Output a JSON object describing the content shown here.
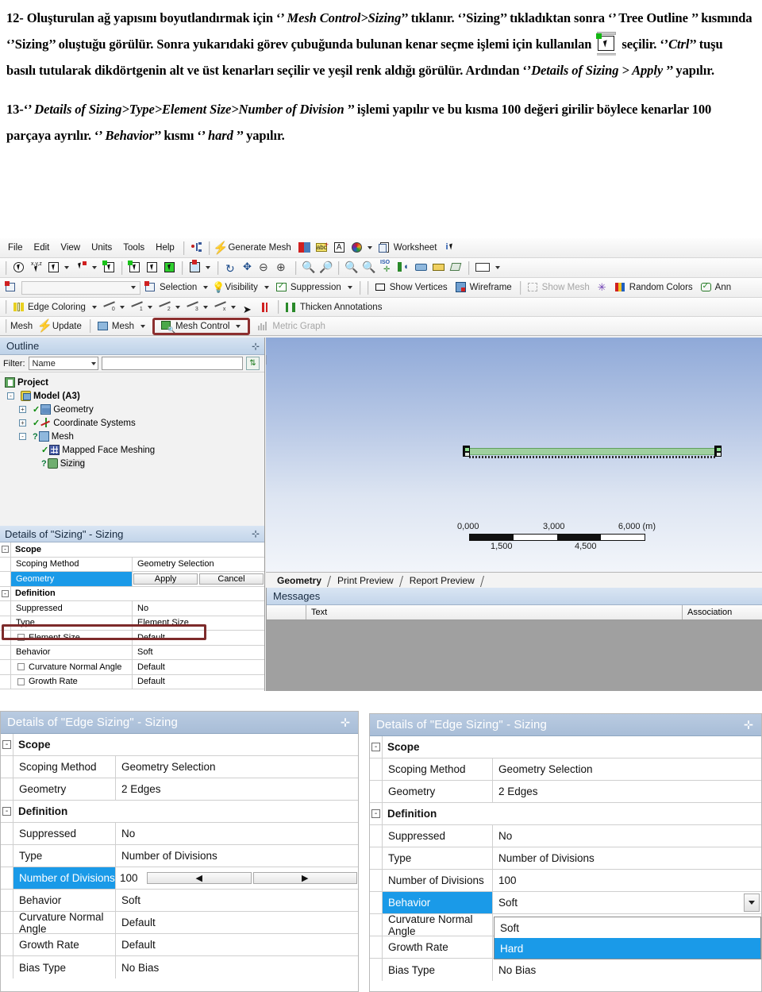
{
  "document": {
    "paragraph_12": {
      "prefix": "12- Oluşturulan ağ yapısını boyutlandırmak için ‘’ ",
      "em1": "Mesh Control>Sizing",
      "mid1": "’’ tıklanır.  ‘’Sizing’’ tıkladıktan sonra ‘’ Tree Outline ’’ kısmında ‘’Sizing’’ oluştuğu görülür. Sonra yukarıdaki  görev çubuğunda bulunan kenar seçme işlemi için kullanılan ",
      "mid2": " seçilir.  ‘’",
      "em2": "Ctrl",
      "mid3": "’’ tuşu basılı tutularak dikdörtgenin alt ve üst kenarları seçilir ve yeşil renk aldığı görülür. Ardından ‘’",
      "em3": "Details of Sizing > Apply",
      "suffix": " ’’ yapılır."
    },
    "paragraph_13": {
      "prefix": "13-‘’ ",
      "em1": "Details of Sizing>Type>Element Size>Number of Division",
      "mid1": " ’’ işlemi yapılır ve bu kısma 100 değeri girilir  böylece kenarlar 100 parçaya ayrılır. ‘’ ",
      "em2": "Behavior",
      "mid2": "’’ kısmı ‘’ ",
      "em3": "hard",
      "suffix": " ’’ yapılır."
    }
  },
  "app": {
    "menu": [
      "File",
      "Edit",
      "View",
      "Units",
      "Tools",
      "Help"
    ],
    "toolbar_row1": [
      {
        "label": "Generate Mesh",
        "icon": "lightning-icon"
      },
      {
        "label": "",
        "icon": "new-section-plane-icon"
      },
      {
        "label": "",
        "icon": "abc-label-icon"
      },
      {
        "label": "",
        "icon": "letter-a-icon"
      },
      {
        "label": "",
        "icon": "color-wheel-icon"
      },
      {
        "label": "Worksheet",
        "icon": "worksheet-icon"
      },
      {
        "label": "",
        "icon": "info-cursor-icon"
      }
    ],
    "toolbar_row3": [
      {
        "label": "Selection",
        "icon": "selection-icon"
      },
      {
        "label": "Visibility",
        "icon": "lightbulb-icon"
      },
      {
        "label": "Suppression",
        "icon": "suppression-icon"
      },
      {
        "label": "Show Vertices",
        "icon": "show-vertices-icon"
      },
      {
        "label": "Wireframe",
        "icon": "wireframe-icon"
      },
      {
        "label": "Show Mesh",
        "icon": "show-mesh-icon",
        "disabled": true
      },
      {
        "label": "",
        "icon": "edge-direction-icon"
      },
      {
        "label": "Random Colors",
        "icon": "random-colors-icon"
      },
      {
        "label": "Ann",
        "icon": "annotation-icon"
      }
    ],
    "toolbar_row4": [
      {
        "label": "Edge Coloring",
        "icon": "edge-coloring-icon"
      },
      {
        "label": "Thicken Annotations",
        "icon": "thicken-annotations-icon"
      }
    ],
    "toolbar_row5": {
      "mesh_label": "Mesh",
      "update_label": "Update",
      "mesh_menu_label": "Mesh",
      "mesh_control_label": "Mesh Control",
      "metric_graph_label": "Metric Graph",
      "highlight_color": "#8c2f2f"
    }
  },
  "outline": {
    "title": "Outline",
    "pin": "⊹",
    "filter": {
      "label": "Filter:",
      "selected": "Name",
      "value": "",
      "refresh_icon": "refresh-icon"
    },
    "tree": [
      {
        "label": "Project",
        "depth": 0,
        "icon": "project-icon",
        "bold": true,
        "expander": "",
        "status": ""
      },
      {
        "label": "Model (A3)",
        "depth": 1,
        "icon": "model-icon",
        "bold": true,
        "expander": "-",
        "status": ""
      },
      {
        "label": "Geometry",
        "depth": 2,
        "icon": "geometry-icon",
        "bold": false,
        "expander": "+",
        "status": "check"
      },
      {
        "label": "Coordinate Systems",
        "depth": 2,
        "icon": "coordinate-systems-icon",
        "bold": false,
        "expander": "+",
        "status": "check"
      },
      {
        "label": "Mesh",
        "depth": 2,
        "icon": "mesh-icon",
        "bold": false,
        "expander": "-",
        "status": "question"
      },
      {
        "label": "Mapped Face Meshing",
        "depth": 3,
        "icon": "mapped-face-meshing-icon",
        "bold": false,
        "expander": "",
        "status": "check"
      },
      {
        "label": "Sizing",
        "depth": 3,
        "icon": "sizing-icon",
        "bold": false,
        "expander": "",
        "status": "question",
        "selected": true
      }
    ]
  },
  "details_sizing": {
    "title": "Details of \"Sizing\" - Sizing",
    "pin": "⊹",
    "highlight_color": "#7d2b2b",
    "rows": [
      {
        "kind": "group",
        "label": "Scope",
        "expander": "-"
      },
      {
        "kind": "pair",
        "key": "Scoping Method",
        "value": "Geometry Selection"
      },
      {
        "kind": "apply",
        "key": "Geometry",
        "apply": "Apply",
        "cancel": "Cancel",
        "selected": true
      },
      {
        "kind": "group",
        "label": "Definition",
        "expander": "-"
      },
      {
        "kind": "pair",
        "key": "Suppressed",
        "value": "No"
      },
      {
        "kind": "pair",
        "key": "Type",
        "value": "Element Size",
        "highlighted": true
      },
      {
        "kind": "pair",
        "key": "Element Size",
        "value": "Default",
        "checkbox": true
      },
      {
        "kind": "pair",
        "key": "Behavior",
        "value": "Soft"
      },
      {
        "kind": "pair",
        "key": "Curvature Normal Angle",
        "value": "Default",
        "checkbox": true
      },
      {
        "kind": "pair",
        "key": "Growth Rate",
        "value": "Default",
        "checkbox": true
      }
    ]
  },
  "viewport": {
    "scale_bar": {
      "labels_top": [
        "0,000",
        "3,000",
        "6,000 (m)"
      ],
      "labels_bottom": [
        "1,500",
        "4,500"
      ],
      "segments": [
        "blk",
        "wht",
        "blk",
        "wht"
      ]
    },
    "selection_color": "#9fd09f",
    "tabs": [
      {
        "label": "Geometry",
        "active": true
      },
      {
        "label": "Print Preview",
        "active": false
      },
      {
        "label": "Report Preview",
        "active": false
      }
    ]
  },
  "messages": {
    "title": "Messages",
    "columns": [
      "",
      "Text",
      "Association"
    ],
    "rows": []
  },
  "details_edge_sizing_left": {
    "title": "Details of \"Edge Sizing\" - Sizing",
    "pin": "⊹",
    "rows": [
      {
        "kind": "group",
        "label": "Scope",
        "expander": "-"
      },
      {
        "kind": "pair",
        "key": "Scoping Method",
        "value": "Geometry Selection"
      },
      {
        "kind": "pair",
        "key": "Geometry",
        "value": "2 Edges"
      },
      {
        "kind": "group",
        "label": "Definition",
        "expander": "-"
      },
      {
        "kind": "pair",
        "key": "Suppressed",
        "value": "No"
      },
      {
        "kind": "pair",
        "key": "Type",
        "value": "Number of Divisions"
      },
      {
        "kind": "spinner",
        "key": "Number of Divisions",
        "value": "100",
        "dec": "◀",
        "inc": "▶",
        "selected": true
      },
      {
        "kind": "pair",
        "key": "Behavior",
        "value": "Soft"
      },
      {
        "kind": "pair",
        "key": "Curvature Normal Angle",
        "value": "Default"
      },
      {
        "kind": "pair",
        "key": "Growth Rate",
        "value": "Default"
      },
      {
        "kind": "pair",
        "key": "Bias Type",
        "value": "No Bias"
      }
    ]
  },
  "details_edge_sizing_right": {
    "title": "Details of \"Edge Sizing\" - Sizing",
    "pin": "⊹",
    "rows": [
      {
        "kind": "group",
        "label": "Scope",
        "expander": "-"
      },
      {
        "kind": "pair",
        "key": "Scoping Method",
        "value": "Geometry Selection"
      },
      {
        "kind": "pair",
        "key": "Geometry",
        "value": "2 Edges"
      },
      {
        "kind": "group",
        "label": "Definition",
        "expander": "-"
      },
      {
        "kind": "pair",
        "key": "Suppressed",
        "value": "No"
      },
      {
        "kind": "pair",
        "key": "Type",
        "value": "Number of Divisions"
      },
      {
        "kind": "pair",
        "key": "Number of Divisions",
        "value": "100"
      },
      {
        "kind": "combo",
        "key": "Behavior",
        "value": "Soft",
        "selected": true
      },
      {
        "kind": "pair",
        "key": "Curvature Normal Angle",
        "value": "Default"
      },
      {
        "kind": "pair",
        "key": "Growth Rate",
        "value": "Default"
      },
      {
        "kind": "pair",
        "key": "Bias Type",
        "value": "No Bias"
      }
    ],
    "dropdown": {
      "options": [
        "Soft",
        "Hard"
      ],
      "highlighted": "Hard",
      "highlight_color": "#1a9ae8"
    }
  }
}
